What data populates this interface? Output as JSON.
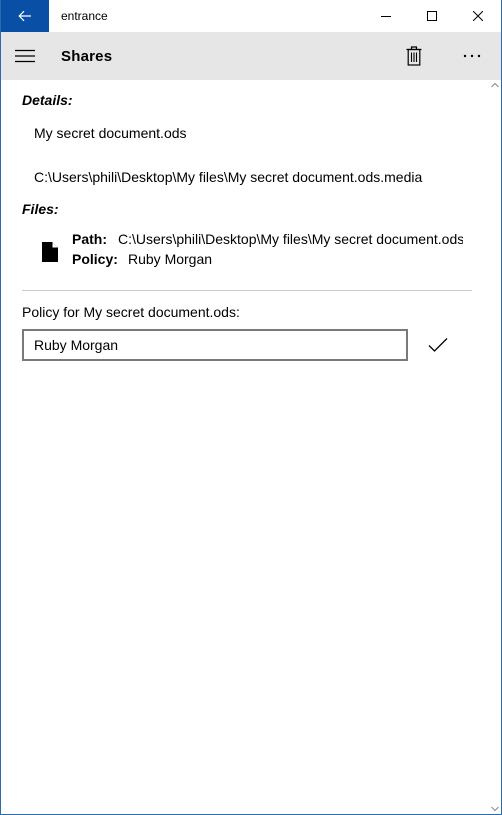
{
  "window": {
    "title": "entrance",
    "accent": "#0a4fa6"
  },
  "cmdbar": {
    "title": "Shares"
  },
  "details": {
    "heading": "Details:",
    "name": "My secret document.ods",
    "media_path": "C:\\Users\\phili\\Desktop\\My files\\My secret document.ods.media"
  },
  "files": {
    "heading": "Files:",
    "items": [
      {
        "path_label": "Path:",
        "path_value": "C:\\Users\\phili\\Desktop\\My files\\My secret document.ods",
        "policy_label": "Policy:",
        "policy_value": "Ruby Morgan"
      }
    ]
  },
  "policy_editor": {
    "label": "Policy for My secret document.ods:",
    "value": "Ruby Morgan"
  },
  "icons": {
    "back": "back-arrow-icon",
    "minimize": "minimize-icon",
    "maximize": "maximize-icon",
    "close": "close-icon",
    "menu": "hamburger-icon",
    "delete": "trash-icon",
    "more": "more-icon",
    "file": "file-icon",
    "accept": "checkmark-icon"
  }
}
